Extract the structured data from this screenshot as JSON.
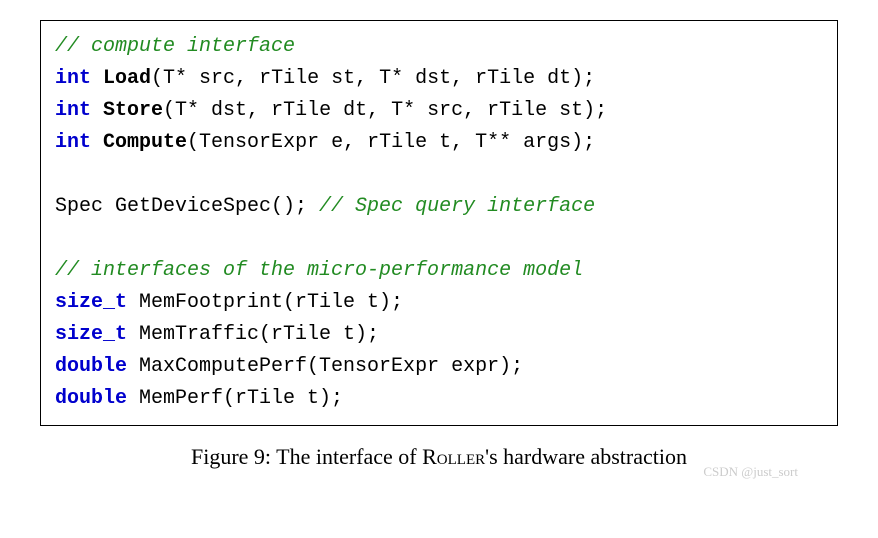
{
  "code": {
    "c1": "// compute interface",
    "l1_kw": "int",
    "l1_fn": "Load",
    "l1_rest": "(T* src, rTile st, T* dst, rTile dt);",
    "l2_kw": "int",
    "l2_fn": "Store",
    "l2_rest": "(T* dst, rTile dt, T* src, rTile st);",
    "l3_kw": "int",
    "l3_fn": "Compute",
    "l3_rest": "(TensorExpr e, rTile t, T** args);",
    "l4_pre": "Spec GetDeviceSpec(); ",
    "l4_comment": "// Spec query interface",
    "c2": "// interfaces of the micro-performance model",
    "l5_kw": "size_t",
    "l5_rest": " MemFootprint(rTile t);",
    "l6_kw": "size_t",
    "l6_rest": " MemTraffic(rTile t);",
    "l7_kw": "double",
    "l7_rest": " MaxComputePerf(TensorExpr expr);",
    "l8_kw": "double",
    "l8_rest": " MemPerf(rTile t);"
  },
  "caption": {
    "label": "Figure 9: The interface of ",
    "roller": "Roller",
    "suffix": "'s hardware abstraction"
  },
  "watermark": "CSDN @just_sort"
}
